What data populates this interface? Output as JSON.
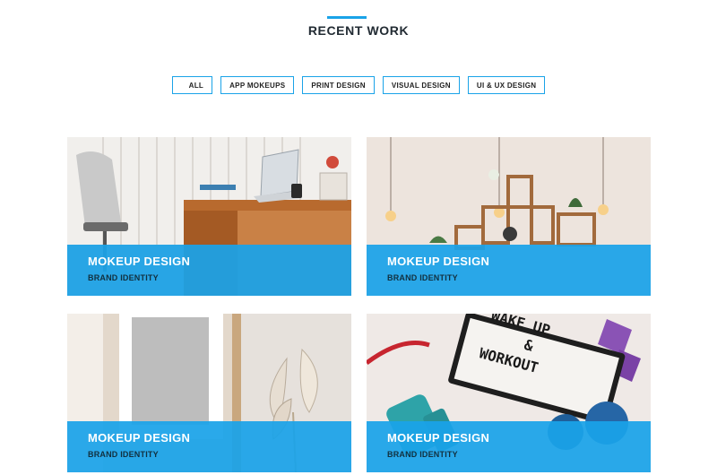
{
  "section": {
    "title": "RECENT WORK"
  },
  "filters": [
    {
      "label": "ALL"
    },
    {
      "label": "APP MOKEUPS"
    },
    {
      "label": "PRINT DESIGN"
    },
    {
      "label": "VISUAL DESIGN"
    },
    {
      "label": "UI & UX DESIGN"
    }
  ],
  "portfolio": [
    {
      "title": "MOKEUP DESIGN",
      "subtitle": "BRAND IDENTITY",
      "image": "office-desk-photo"
    },
    {
      "title": "MOKEUP DESIGN",
      "subtitle": "BRAND IDENTITY",
      "image": "hanging-bulbs-shelf-photo"
    },
    {
      "title": "MOKEUP DESIGN",
      "subtitle": "BRAND IDENTITY",
      "image": "frame-dried-palm-photo"
    },
    {
      "title": "MOKEUP DESIGN",
      "subtitle": "BRAND IDENTITY",
      "image": "wake-up-workout-lightbox-photo"
    }
  ],
  "colors": {
    "accent": "#1aa3e8",
    "caption_overlay": "#1aa3e8",
    "text_dark": "#222b33"
  }
}
